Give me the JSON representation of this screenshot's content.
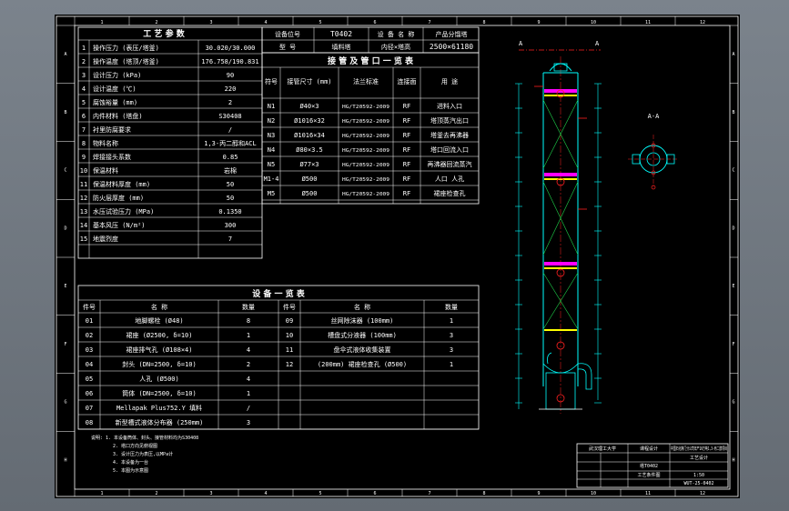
{
  "zones": {
    "cols": [
      "1",
      "2",
      "3",
      "4",
      "5",
      "6",
      "7",
      "8",
      "9",
      "10",
      "11",
      "12"
    ],
    "rows": [
      "A",
      "B",
      "C",
      "D",
      "E",
      "F",
      "G",
      "H"
    ]
  },
  "process": {
    "title": "工 艺 参 数",
    "rows": [
      {
        "no": "1",
        "name": "操作压力 (表压/塔釜)",
        "value": "30.020/30.000"
      },
      {
        "no": "2",
        "name": "操作温度 (塔顶/塔釜)",
        "value": "176.758/190.831"
      },
      {
        "no": "3",
        "name": "设计压力 (kPa)",
        "value": "90"
      },
      {
        "no": "4",
        "name": "设计温度 (℃)",
        "value": "220"
      },
      {
        "no": "5",
        "name": "腐蚀裕量 (mm)",
        "value": "2"
      },
      {
        "no": "6",
        "name": "内件材料 (塔盘)",
        "value": "S30408"
      },
      {
        "no": "7",
        "name": "衬里防腐要求",
        "value": "/"
      },
      {
        "no": "8",
        "name": "物料名称",
        "value": "1,3-丙二醇和ACL"
      },
      {
        "no": "9",
        "name": "焊接接头系数",
        "value": "0.85"
      },
      {
        "no": "10",
        "name": "保温材料",
        "value": "岩棉"
      },
      {
        "no": "11",
        "name": "保温材料厚度 (mm)",
        "value": "50"
      },
      {
        "no": "12",
        "name": "防火层厚度 (mm)",
        "value": "50"
      },
      {
        "no": "13",
        "name": "水压试验压力 (MPa)",
        "value": "0.1350"
      },
      {
        "no": "14",
        "name": "基本风压 (N/m²)",
        "value": "300"
      },
      {
        "no": "15",
        "name": "地震烈度",
        "value": "7"
      }
    ]
  },
  "device": {
    "pos_label": "设备位号",
    "pos_value": "T0402",
    "name_label": "设 备 名 称",
    "name_value": "产品分馏塔",
    "type_label": "型  号",
    "type_mid": "填料塔",
    "type_value1": "内径×塔高",
    "type_value2": "2500×61180"
  },
  "nozzle": {
    "title": "接 管 及 管 口 一 览 表",
    "headers": {
      "sym": "符号",
      "size": "接管尺寸 (mm)",
      "std": "法兰标准",
      "face": "连接面",
      "use": "用  途"
    },
    "rows": [
      {
        "sym": "N1",
        "size": "Ø40×3",
        "std": "HG/T20592-2009",
        "face": "RF",
        "use": "进料入口"
      },
      {
        "sym": "N2",
        "size": "Ø1016×32",
        "std": "HG/T20592-2009",
        "face": "RF",
        "use": "塔顶蒸汽出口"
      },
      {
        "sym": "N3",
        "size": "Ø1016×34",
        "std": "HG/T20592-2009",
        "face": "RF",
        "use": "塔釜去再沸器"
      },
      {
        "sym": "N4",
        "size": "Ø80×3.5",
        "std": "HG/T20592-2009",
        "face": "RF",
        "use": "塔口回流入口"
      },
      {
        "sym": "N5",
        "size": "Ø77×3",
        "std": "HG/T20592-2009",
        "face": "RF",
        "use": "再沸器回流蒸汽"
      },
      {
        "sym": "M1-4",
        "size": "Ø500",
        "std": "HG/T20592-2009",
        "face": "RF",
        "use": "人口  人孔"
      },
      {
        "sym": "M5",
        "size": "Ø500",
        "std": "HG/T20592-2009",
        "face": "RF",
        "use": "裙座检查孔"
      }
    ]
  },
  "parts": {
    "title": "设 备 一 览 表",
    "headers": {
      "no": "件号",
      "name": "名  称",
      "qty": "数量"
    },
    "rows": [
      {
        "no": "01",
        "name": "地脚螺栓 (Ø48)",
        "qty": "8",
        "no2": "09",
        "name2": "丝网除沫器 (100mm)",
        "qty2": "1"
      },
      {
        "no": "02",
        "name": "裙座 (Ø2500, δ=10)",
        "qty": "1",
        "no2": "10",
        "name2": "槽盘式分液器 (100mm)",
        "qty2": "3"
      },
      {
        "no": "03",
        "name": "裙座排气孔 (Ø108×4)",
        "qty": "4",
        "no2": "11",
        "name2": "盘伞式液体收集装置",
        "qty2": "3"
      },
      {
        "no": "04",
        "name": "封头 (DN=2500, δ=10)",
        "qty": "2",
        "no2": "12",
        "name2": "(200mm) 裙座检查孔 (Ø500)",
        "qty2": "1"
      },
      {
        "no": "05",
        "name": "人孔 (Ø500)",
        "qty": "4",
        "no2": "",
        "name2": "",
        "qty2": ""
      },
      {
        "no": "06",
        "name": "筒体 (DN=2500, δ=10)",
        "qty": "1",
        "no2": "",
        "name2": "",
        "qty2": ""
      },
      {
        "no": "07",
        "name": "Mellapak Plus752.Y 填料",
        "qty": "/",
        "no2": "",
        "name2": "",
        "qty2": ""
      },
      {
        "no": "08",
        "name": "新型槽式液体分布器 (250mm)",
        "qty": "3",
        "no2": "",
        "name2": "",
        "qty2": ""
      }
    ]
  },
  "notes": [
    "说明: 1. 本设备筒体、封头、接管材料均为S30408",
    "2. 塔口方向见俯视图",
    "3. 设计压力为表压,以MPa计",
    "4. 本设备为一台",
    "5. 本图为示意图"
  ],
  "drawing": {
    "section_top": "A",
    "section_view": "A-A"
  },
  "titleblock": {
    "school": "武汉理工大学",
    "school2": "课程设计",
    "project": "中国石化荆门分公司年产10万吨1,3-丙二醇项目",
    "project2": "工艺设计",
    "drawing_name": "塔T0402",
    "drawing_name2": "工艺条件图",
    "scale": "1:50",
    "drawing_no": "WUT-25-0402"
  },
  "colors": {
    "sheet": "#000000",
    "line": "#ffffff",
    "vessel": "#00ffff",
    "packing": "#ff00ff",
    "nozzle": "#ff2020",
    "accent": "#ffff00"
  }
}
